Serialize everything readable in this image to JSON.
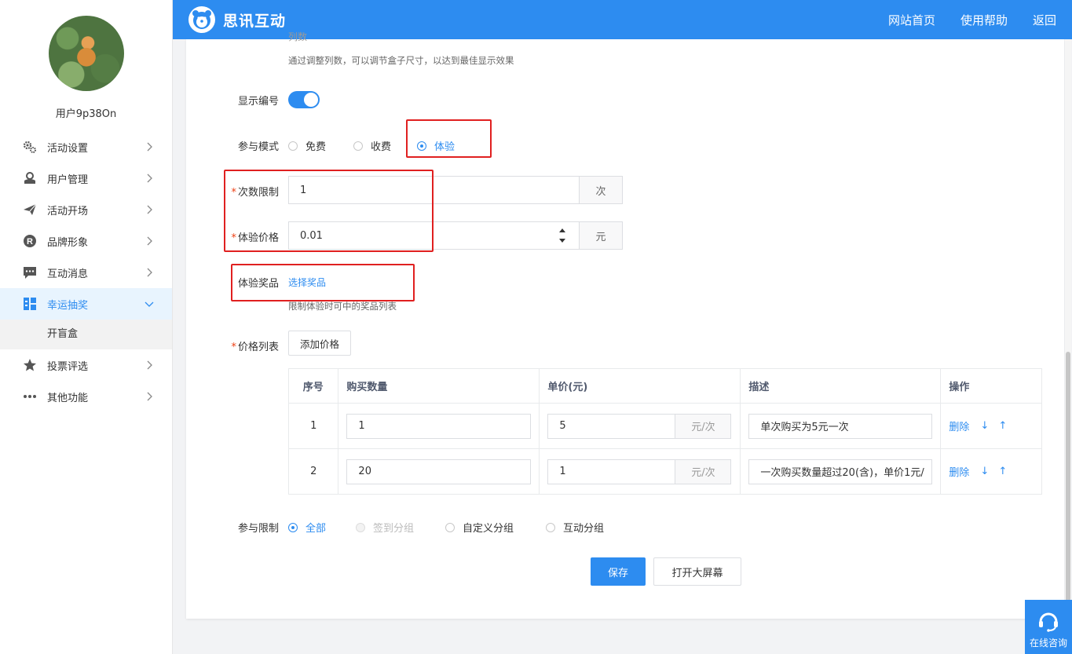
{
  "sidebar": {
    "username": "用户9p38On",
    "menu": [
      {
        "label": "活动设置",
        "icon": "gears-icon"
      },
      {
        "label": "用户管理",
        "icon": "user-icon"
      },
      {
        "label": "活动开场",
        "icon": "paper-plane-icon"
      },
      {
        "label": "品牌形象",
        "icon": "registered-icon"
      },
      {
        "label": "互动消息",
        "icon": "message-icon"
      },
      {
        "label": "幸运抽奖",
        "icon": "lottery-icon",
        "active": true
      },
      {
        "label": "投票评选",
        "icon": "star-icon"
      },
      {
        "label": "其他功能",
        "icon": "more-icon"
      }
    ],
    "submenu": [
      "开盲盒"
    ]
  },
  "topbar": {
    "logo_text": "思讯互动",
    "nav": [
      "网站首页",
      "使用帮助",
      "返回"
    ]
  },
  "form": {
    "cols_hint_cut": "列数",
    "cols_hint": "通过调整列数，可以调节盒子尺寸，以达到最佳显示效果",
    "show_number_label": "显示编号",
    "show_number_on": true,
    "mode_label": "参与模式",
    "mode_options": [
      "免费",
      "收费",
      "体验"
    ],
    "mode_selected": "体验",
    "count_label": "次数限制",
    "count_value": "1",
    "count_unit": "次",
    "price_label": "体验价格",
    "price_value": "0.01",
    "price_unit": "元",
    "prize_label": "体验奖品",
    "prize_link": "选择奖品",
    "prize_hint": "限制体验时可中的奖品列表",
    "price_list_label": "价格列表",
    "add_price_btn": "添加价格",
    "restrict_label": "参与限制",
    "restrict_options": [
      "全部",
      "签到分组",
      "自定义分组",
      "互动分组"
    ],
    "restrict_selected": "全部",
    "save_btn": "保存",
    "open_screen_btn": "打开大屏幕"
  },
  "price_table": {
    "headers": [
      "序号",
      "购买数量",
      "单价(元)",
      "描述",
      "操作"
    ],
    "unit": "元/次",
    "delete_label": "删除",
    "rows": [
      {
        "no": "1",
        "qty": "1",
        "price": "5",
        "desc": "单次购买为5元一次"
      },
      {
        "no": "2",
        "qty": "20",
        "price": "1",
        "desc": "一次购买数量超过20(含)，单价1元/"
      }
    ]
  },
  "float_help": {
    "label": "在线咨询"
  },
  "colors": {
    "primary": "#2d8cf0",
    "annotation": "#e02020"
  }
}
